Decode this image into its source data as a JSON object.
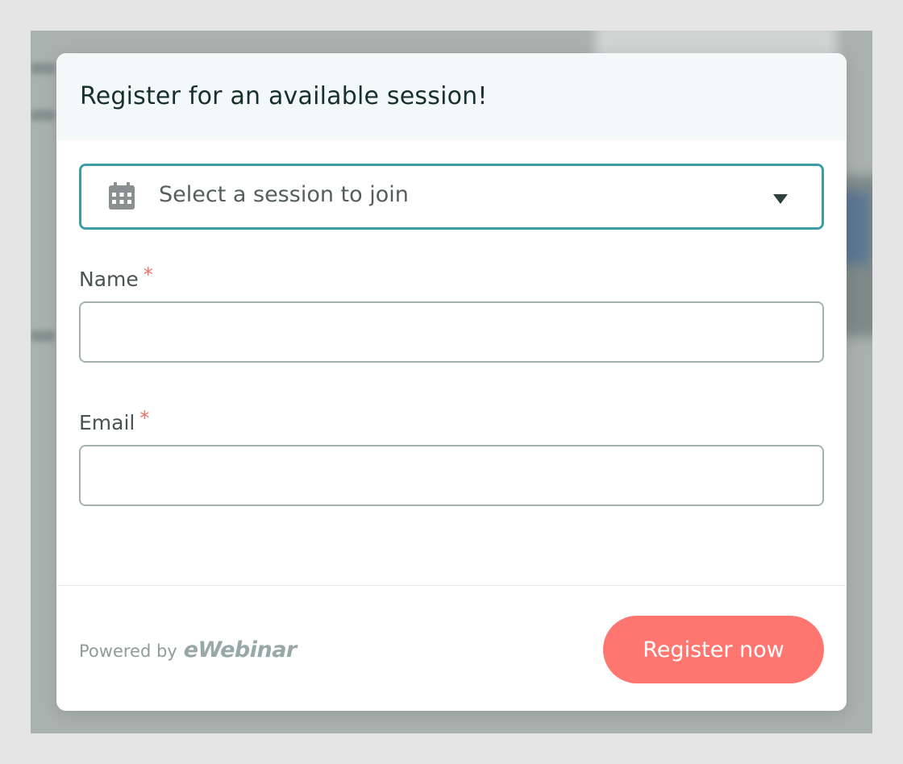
{
  "modal": {
    "title": "Register for an available session!"
  },
  "session_select": {
    "placeholder": "Select a session to join",
    "icon": "calendar-icon",
    "caret_icon": "caret-down-icon"
  },
  "form": {
    "name_label": "Name",
    "email_label": "Email",
    "required_mark": "*",
    "name_value": "",
    "email_value": ""
  },
  "footer": {
    "powered_by": "Powered by",
    "brand": "eWebinar",
    "register_label": "Register now"
  },
  "colors": {
    "accent_border": "#3f9ca6",
    "button": "#ff756f",
    "required": "#f07168",
    "header_bg": "#f3f8f8"
  }
}
